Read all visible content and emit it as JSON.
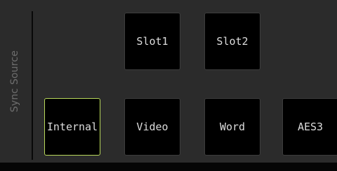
{
  "sync_source": {
    "label": "Sync Source",
    "slot_buttons": [
      {
        "label": "Slot1"
      },
      {
        "label": "Slot2"
      }
    ],
    "source_buttons": [
      {
        "label": "Internal",
        "selected": true
      },
      {
        "label": "Video",
        "selected": false
      },
      {
        "label": "Word",
        "selected": false
      },
      {
        "label": "AES3",
        "selected": false
      }
    ]
  },
  "colors": {
    "panel_bg": "#2b2b2b",
    "button_bg": "#000000",
    "button_border": "#3d3d3d",
    "selected_border": "#b7d75a",
    "label_text": "#6e6e6e",
    "button_text": "#dcdcdc"
  }
}
